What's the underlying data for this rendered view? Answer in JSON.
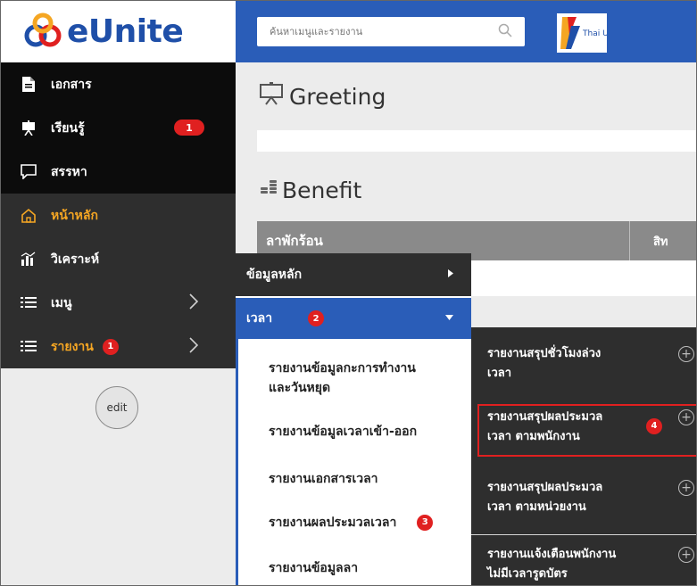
{
  "app": {
    "logo_text": "eUnite",
    "partner_logo_text": "Thai Union"
  },
  "search": {
    "placeholder": "ค้นหาเมนูและรายงาน"
  },
  "sidebar": {
    "items": [
      {
        "label": "เอกสาร"
      },
      {
        "label": "เรียนรู้",
        "badge": "1"
      },
      {
        "label": "สรรหา"
      },
      {
        "label": "หน้าหลัก"
      },
      {
        "label": "วิเคราะห์"
      },
      {
        "label": "เมนู"
      },
      {
        "label": "รายงาน",
        "badge": "1"
      }
    ],
    "edit_label": "edit"
  },
  "main": {
    "greeting_title": "Greeting",
    "benefit_title": "Benefit",
    "benefit_col1": "ลาพักร้อน",
    "benefit_col2": "สิท"
  },
  "flyout1": {
    "items": [
      {
        "label": "ข้อมูลหลัก"
      },
      {
        "label": "เวลา",
        "badge": "2"
      }
    ],
    "sub_items": [
      {
        "line1": "รายงานข้อมูลกะการทำงาน",
        "line2": "และวันหยุด"
      },
      {
        "line1": "รายงานข้อมูลเวลาเข้า-ออก"
      },
      {
        "line1": "รายงานเอกสารเวลา"
      },
      {
        "line1": "รายงานผลประมวลเวลา",
        "badge": "3"
      },
      {
        "line1": "รายงานข้อมูลลา"
      }
    ]
  },
  "flyout2": {
    "items": [
      {
        "line1": "รายงานสรุปชั่วโมงล่วง",
        "line2": "เวลา"
      },
      {
        "line1": "รายงานสรุปผลประมวล",
        "line2": "เวลา ตามพนักงาน",
        "badge": "4"
      },
      {
        "line1": "รายงานสรุปผลประมวล",
        "line2": "เวลา ตามหน่วยงาน"
      },
      {
        "line1": "รายงานแจ้งเตือนพนักงาน",
        "line2": "ไม่มีเวลารูดบัตร"
      }
    ]
  },
  "colors": {
    "brand_blue": "#2a5db8",
    "accent_orange": "#f5a623",
    "badge_red": "#e02020",
    "highlight_red": "#e02020"
  }
}
